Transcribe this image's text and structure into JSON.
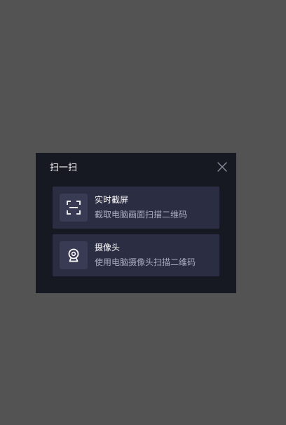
{
  "dialog": {
    "title": "扫一扫",
    "close_icon": "close-icon",
    "options": [
      {
        "icon": "screenshot-scan-icon",
        "title": "实时截屏",
        "description": "截取电脑画面扫描二维码"
      },
      {
        "icon": "camera-icon",
        "title": "摄像头",
        "description": "使用电脑摄像头扫描二维码"
      }
    ]
  },
  "colors": {
    "backdrop": "#535353",
    "dialog_bg": "#161922",
    "option_bg": "#2b2d42",
    "icon_box_bg": "#393b54",
    "primary_text": "#ffffff",
    "secondary_text": "#a9abbe"
  }
}
